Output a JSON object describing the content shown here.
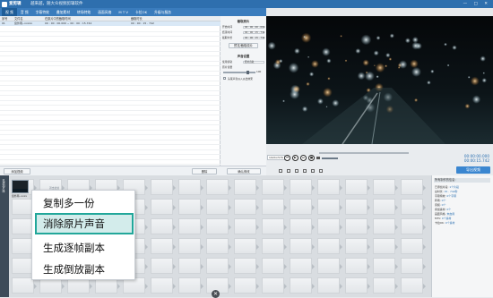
{
  "app": {
    "title": "爱剪辑",
    "subtitle": "越来越，随大众视频剪辑软件"
  },
  "tabs": [
    "视 频",
    "音 频",
    "字幕特效",
    "叠加素材",
    "转场特效",
    "画面风格",
    "M T V",
    "卡拉OK",
    "升级与服务"
  ],
  "table": {
    "headers": [
      "序号",
      "文件名",
      "在原片中的截取时间",
      "截取时长"
    ],
    "row1": {
      "index": "01",
      "name": "窗外雨--xxxxx",
      "range": "00 : 00 : 00.000 ~ 00 : 00 : 15.742",
      "duration": "00 : 00 : 15 . 742"
    }
  },
  "actions": {
    "add_video": "添加视频",
    "delete": "删除",
    "confirm": "确认修改"
  },
  "form": {
    "section1": "截取原片",
    "start_label": "开始时间",
    "start": "00 : 00 : 00 . 000",
    "end_label": "结束时间",
    "end": "00 : 00 : 15 . 742",
    "dur_label": "截取时长",
    "dur": "00 : 00 : 15 . 742",
    "preview_btn": "预览/截取原片",
    "section2": "声音设置",
    "track_label": "使用音轨",
    "track": "原片音轨",
    "vol_label": "原片音量",
    "vol_value": "100",
    "check_label": "头尾声音淡入淡出效果"
  },
  "player": {
    "resolution": "1024×576",
    "current": "00:00:00.000",
    "total": "00:00:15.742",
    "export": "导出视频"
  },
  "props": {
    "title": "所有制作的信息：",
    "rows": [
      {
        "k": "已添加片段:",
        "v": "1个片段"
      },
      {
        "k": "总时长:",
        "v": "15 . 742秒"
      },
      {
        "k": "字幕特效:",
        "v": "0个字幕"
      },
      {
        "k": "转场:",
        "v": "0个"
      },
      {
        "k": "音频:",
        "v": "0个"
      },
      {
        "k": "叠加素材:",
        "v": "0个"
      },
      {
        "k": "画面风格:",
        "v": "未启用"
      },
      {
        "k": "MTV:",
        "v": "0个素材"
      },
      {
        "k": "卡拉OK:",
        "v": "0个素材"
      }
    ]
  },
  "timeline": {
    "sidebar_label": "已添加片段",
    "clip_label": "窗外雨--xxxx",
    "hint": "双击此处"
  },
  "context_menu": {
    "items": [
      "复制多一份",
      "消除原片声音",
      "生成逐帧副本",
      "生成倒放副本"
    ],
    "highlighted_index": 1
  },
  "colors": {
    "accent": "#2e6fae",
    "highlight_border": "#22a79a",
    "highlight_bg": "#d3eceb"
  }
}
